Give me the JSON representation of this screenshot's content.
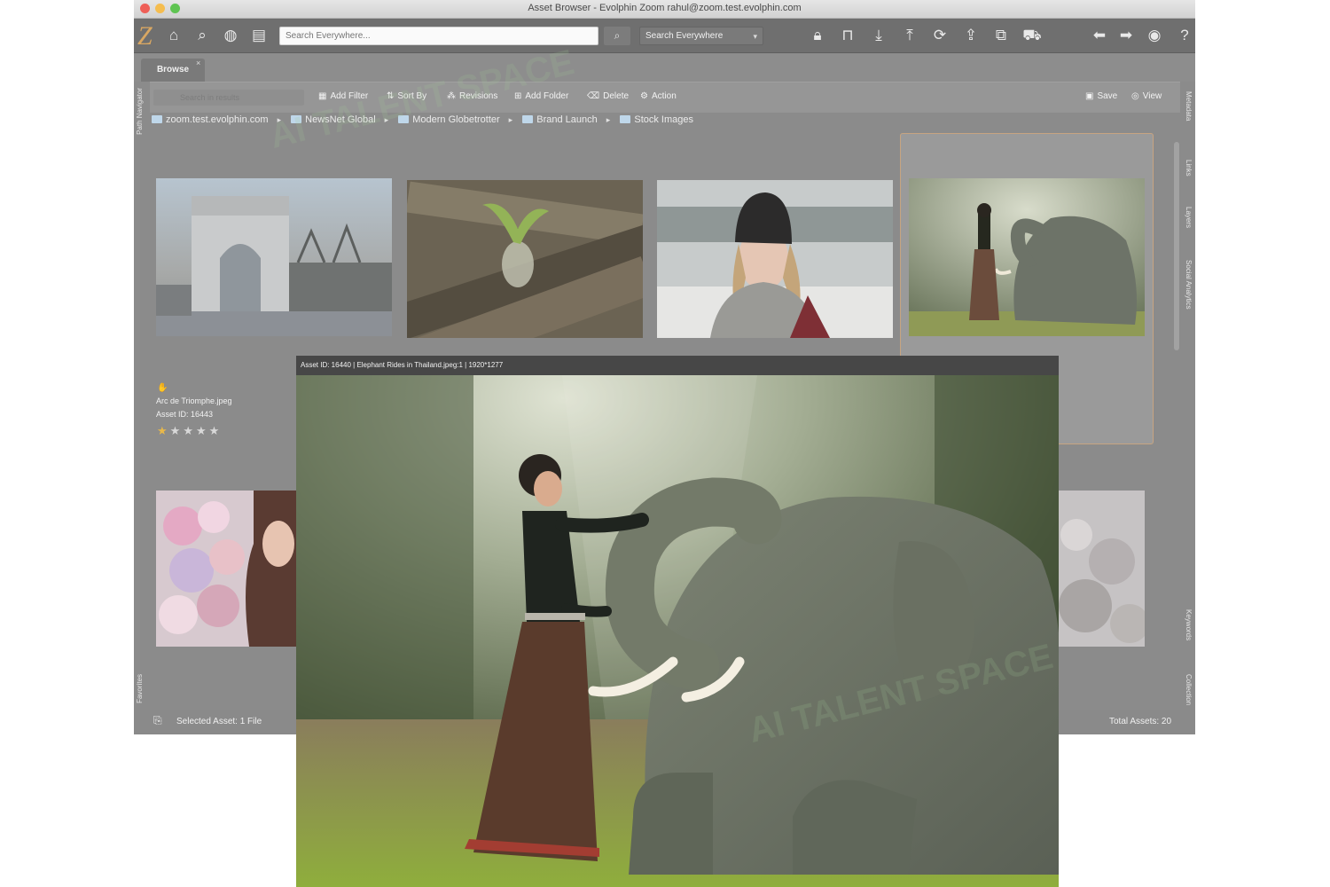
{
  "window": {
    "title": "Asset Browser - Evolphin Zoom rahul@zoom.test.evolphin.com",
    "logo_letter": "Z"
  },
  "toolbar": {
    "search_placeholder": "Search Everywhere...",
    "search_scope": "Search Everywhere"
  },
  "tabs": [
    {
      "label": "Browse",
      "close": "×"
    }
  ],
  "actions": {
    "search_placeholder": "Search in results",
    "items": [
      "Add Filter",
      "Sort By",
      "Revisions",
      "Add Folder",
      "Delete",
      "Action"
    ],
    "save": "Save",
    "view": "View"
  },
  "breadcrumb": [
    "zoom.test.evolphin.com",
    "NewsNet Global",
    "Modern Globetrotter",
    "Brand Launch",
    "Stock Images"
  ],
  "left_panel": {
    "path_navigator": "Path Navigator",
    "favorites": "Favorites"
  },
  "right_panel": {
    "tabs": [
      "Metadata",
      "Links",
      "Layers",
      "Social Analytics",
      "Keywords",
      "Collection"
    ]
  },
  "selected_asset": {
    "name": "Arc de Triomphe.jpeg",
    "id_label": "Asset ID: 16443",
    "rating": 1,
    "max_rating": 5
  },
  "status": {
    "selected": "Selected Asset: 1 File",
    "total": "Total Assets: 20"
  },
  "preview": {
    "header": "Asset ID: 16440 | Elephant Rides in Thailand.jpeg:1 | 1920*1277"
  },
  "colors": {
    "accent": "#d9a762",
    "star_on": "#e8b84a",
    "star_off": "#d8d8d8"
  },
  "watermark": "AI TALENT SPACE"
}
